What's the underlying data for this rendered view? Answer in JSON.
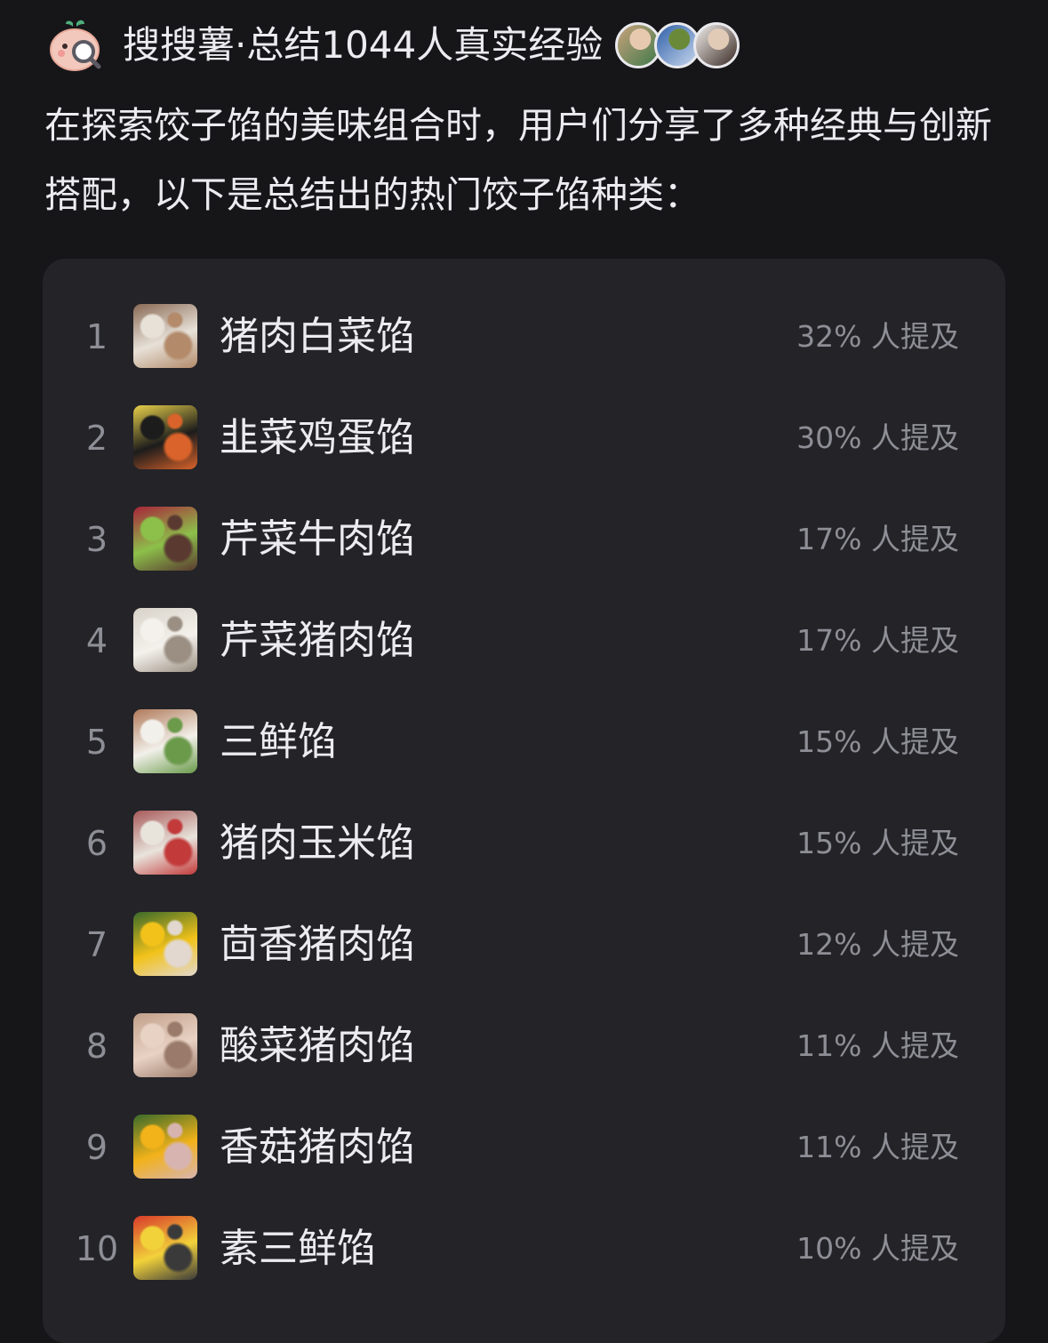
{
  "header": {
    "logo_icon": "sweet-potato-search-icon",
    "brand": "搜搜薯·总结1044人真实经验",
    "avatars": [
      {
        "name": "user-avatar-1",
        "colors": [
          "#c9a27c",
          "#3f7a4a",
          "#e7c9b0"
        ]
      },
      {
        "name": "user-avatar-2",
        "colors": [
          "#2f5fa8",
          "#c8d8ee",
          "#6a8a3a"
        ]
      },
      {
        "name": "user-avatar-3",
        "colors": [
          "#f1efec",
          "#3b2a24",
          "#e2cbb6"
        ]
      }
    ]
  },
  "intro": "在探索饺子馅的美味组合时，用户们分享了多种经典与创新搭配，以下是总结出的热门饺子馅种类：",
  "list": {
    "items": [
      {
        "rank": "1",
        "name": "猪肉白菜馅",
        "stat": "32% 人提及",
        "percent": 32,
        "thumb_colors": [
          "#8a6a55",
          "#e7e1d8",
          "#b38a6a"
        ]
      },
      {
        "rank": "2",
        "name": "韭菜鸡蛋馅",
        "stat": "30% 人提及",
        "percent": 30,
        "thumb_colors": [
          "#e8d04a",
          "#1c1c1c",
          "#d9632a"
        ]
      },
      {
        "rank": "3",
        "name": "芹菜牛肉馅",
        "stat": "17% 人提及",
        "percent": 17,
        "thumb_colors": [
          "#a8243a",
          "#8cc04a",
          "#5a3a30"
        ]
      },
      {
        "rank": "4",
        "name": "芹菜猪肉馅",
        "stat": "17% 人提及",
        "percent": 17,
        "thumb_colors": [
          "#d8d2c8",
          "#f4f1ec",
          "#9a8f82"
        ]
      },
      {
        "rank": "5",
        "name": "三鲜馅",
        "stat": "15% 人提及",
        "percent": 15,
        "thumb_colors": [
          "#b07a5a",
          "#f2f0ea",
          "#6a9a4a"
        ]
      },
      {
        "rank": "6",
        "name": "猪肉玉米馅",
        "stat": "15% 人提及",
        "percent": 15,
        "thumb_colors": [
          "#a85a5a",
          "#e8e4dc",
          "#c23a3a"
        ]
      },
      {
        "rank": "7",
        "name": "茴香猪肉馅",
        "stat": "12% 人提及",
        "percent": 12,
        "thumb_colors": [
          "#3a6a2a",
          "#f2c21a",
          "#e2d8d0"
        ]
      },
      {
        "rank": "8",
        "name": "酸菜猪肉馅",
        "stat": "11% 人提及",
        "percent": 11,
        "thumb_colors": [
          "#c2a08a",
          "#e8d2c4",
          "#9a7a6a"
        ]
      },
      {
        "rank": "9",
        "name": "香菇猪肉馅",
        "stat": "11% 人提及",
        "percent": 11,
        "thumb_colors": [
          "#3a6a2a",
          "#f2b21a",
          "#d8b4b0"
        ]
      },
      {
        "rank": "10",
        "name": "素三鲜馅",
        "stat": "10% 人提及",
        "percent": 10,
        "thumb_colors": [
          "#d83a2a",
          "#f2d23a",
          "#3a3a3a"
        ]
      }
    ]
  }
}
